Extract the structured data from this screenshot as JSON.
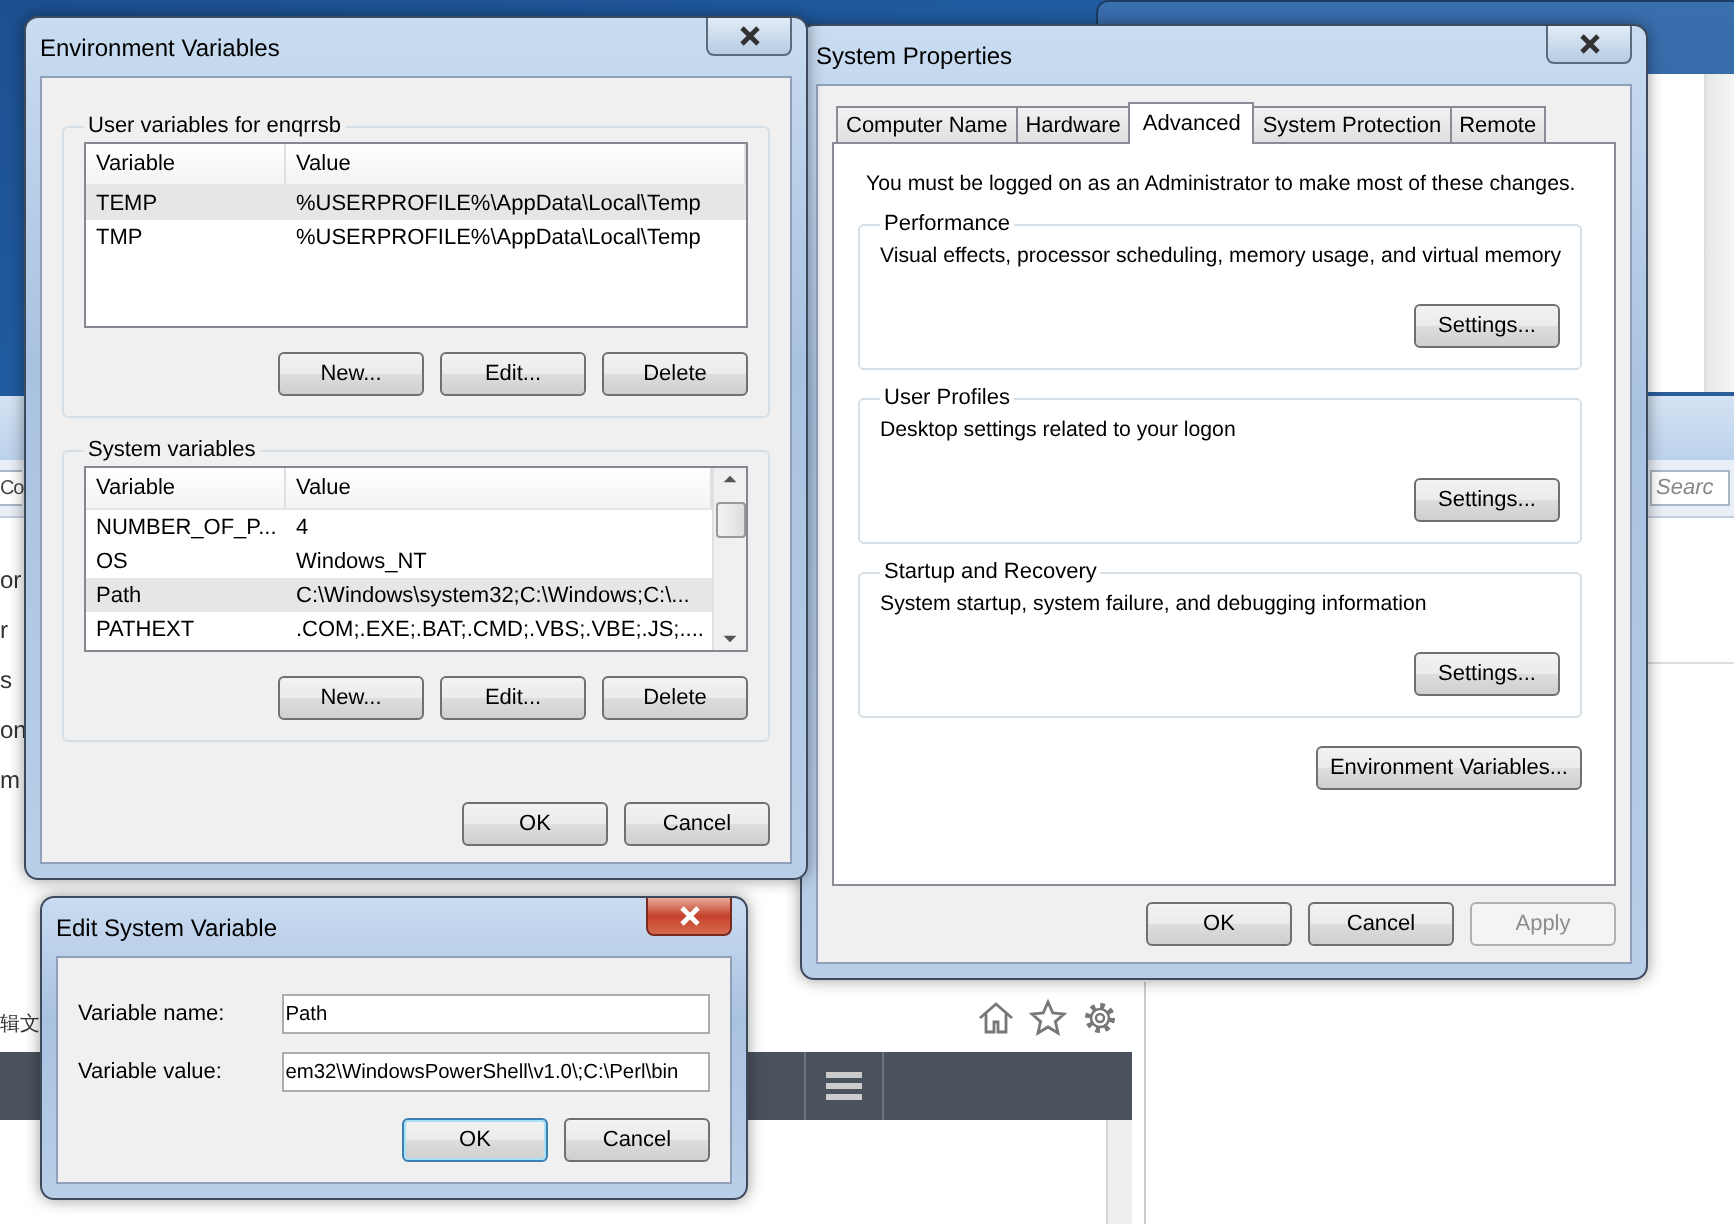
{
  "background": {
    "field_text": "Co",
    "search": {
      "placeholder": "Searc"
    },
    "nav_fragments": [
      "or",
      "r",
      "s",
      "on",
      "m"
    ],
    "page_text": "辑文"
  },
  "environment_variables": {
    "title": "Environment Variables",
    "groups": [
      {
        "label": "User variables for enqrrsb",
        "columns": [
          "Variable",
          "Value"
        ],
        "scrollbar": false,
        "rows": [
          {
            "cells": [
              "TEMP",
              "%USERPROFILE%\\AppData\\Local\\Temp"
            ],
            "selected": true
          },
          {
            "cells": [
              "TMP",
              "%USERPROFILE%\\AppData\\Local\\Temp"
            ],
            "selected": false
          }
        ],
        "buttons": [
          "New...",
          "Edit...",
          "Delete"
        ]
      },
      {
        "label": "System variables",
        "columns": [
          "Variable",
          "Value"
        ],
        "scrollbar": true,
        "rows": [
          {
            "cells": [
              "NUMBER_OF_P...",
              "4"
            ],
            "selected": false
          },
          {
            "cells": [
              "OS",
              "Windows_NT"
            ],
            "selected": false
          },
          {
            "cells": [
              "Path",
              "C:\\Windows\\system32;C:\\Windows;C:\\..."
            ],
            "selected": true
          },
          {
            "cells": [
              "PATHEXT",
              ".COM;.EXE;.BAT;.CMD;.VBS;.VBE;.JS;...."
            ],
            "selected": false
          }
        ],
        "buttons": [
          "New...",
          "Edit...",
          "Delete"
        ]
      }
    ],
    "buttons": [
      "OK",
      "Cancel"
    ]
  },
  "system_properties": {
    "title": "System Properties",
    "tabs": [
      {
        "label": "Computer Name",
        "selected": false
      },
      {
        "label": "Hardware",
        "selected": false
      },
      {
        "label": "Advanced",
        "selected": true
      },
      {
        "label": "System Protection",
        "selected": false
      },
      {
        "label": "Remote",
        "selected": false
      }
    ],
    "notice": "You must be logged on as an Administrator to make most of these changes.",
    "groups": [
      {
        "label": "Performance",
        "description": "Visual effects, processor scheduling, memory usage, and virtual memory",
        "button": "Settings..."
      },
      {
        "label": "User Profiles",
        "description": "Desktop settings related to your logon",
        "button": "Settings..."
      },
      {
        "label": "Startup and Recovery",
        "description": "System startup, system failure, and debugging information",
        "button": "Settings..."
      }
    ],
    "env_button": "Environment Variables...",
    "buttons": [
      {
        "label": "OK",
        "disabled": false
      },
      {
        "label": "Cancel",
        "disabled": false
      },
      {
        "label": "Apply",
        "disabled": true
      }
    ]
  },
  "edit_dialog": {
    "title": "Edit System Variable",
    "fields": [
      {
        "label": "Variable name:",
        "value": "Path"
      },
      {
        "label": "Variable value:",
        "value": "em32\\WindowsPowerShell\\v1.0\\;C:\\Perl\\bin"
      }
    ],
    "buttons": [
      {
        "label": "OK",
        "default": true
      },
      {
        "label": "Cancel",
        "default": false
      }
    ]
  }
}
